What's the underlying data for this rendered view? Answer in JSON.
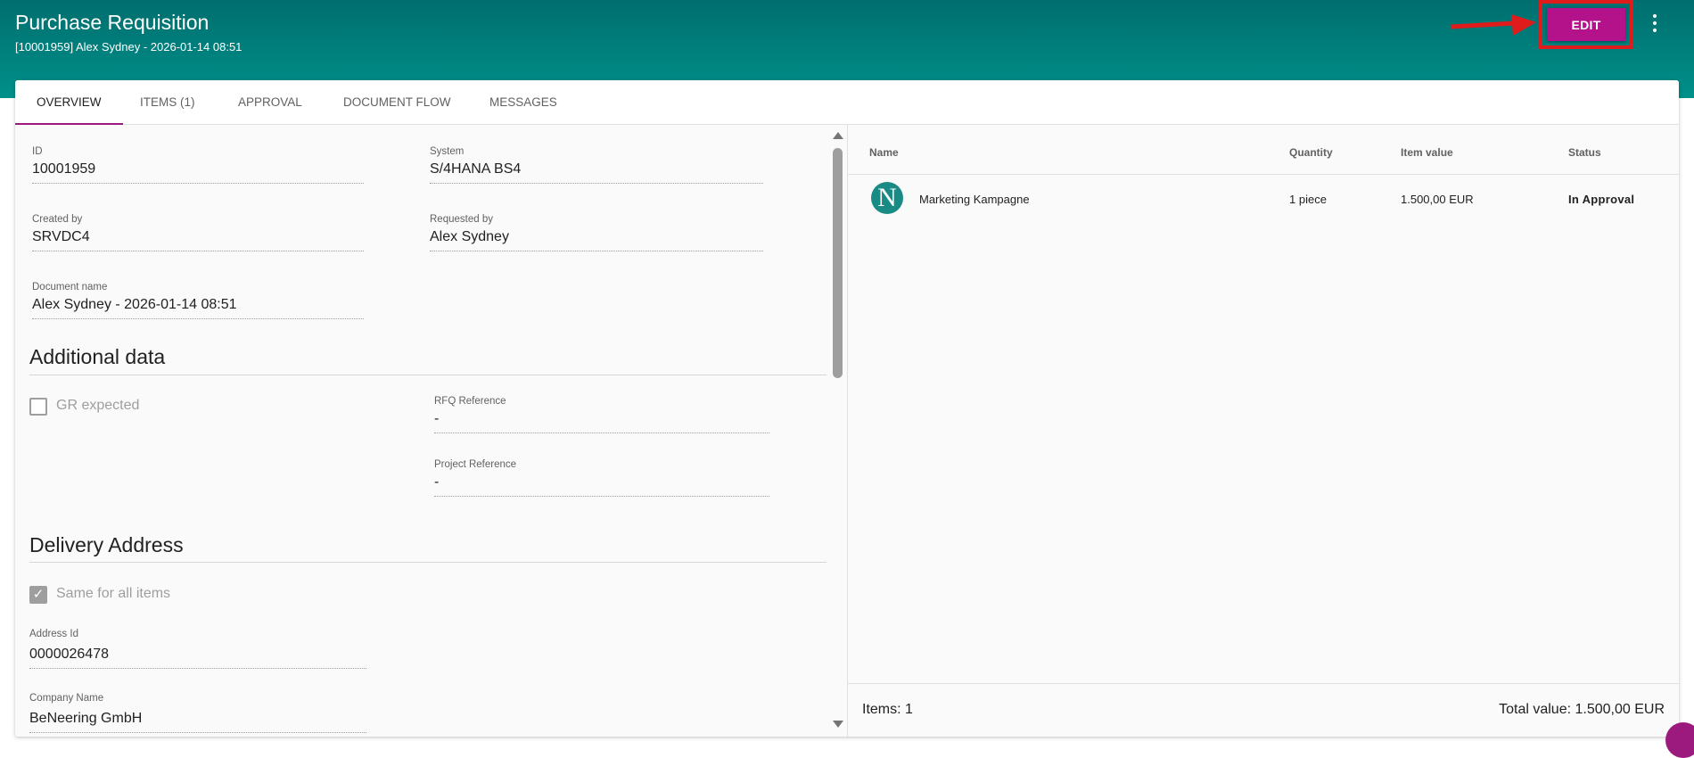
{
  "header": {
    "title": "Purchase Requisition",
    "subtitle": "[10001959] Alex Sydney - 2026-01-14 08:51",
    "edit_label": "EDIT",
    "more_icon": "more-vert-icon",
    "colors": {
      "header_start": "#006e6e",
      "header_end": "#00908a",
      "edit_button": "#b3128a",
      "highlight": "#e01b1b"
    }
  },
  "tabs": [
    {
      "label": "OVERVIEW",
      "active": true
    },
    {
      "label": "ITEMS (1)",
      "active": false
    },
    {
      "label": "APPROVAL",
      "active": false
    },
    {
      "label": "DOCUMENT FLOW",
      "active": false
    },
    {
      "label": "MESSAGES",
      "active": false
    }
  ],
  "overview": {
    "id": {
      "label": "ID",
      "value": "10001959"
    },
    "system": {
      "label": "System",
      "value": "S/4HANA BS4"
    },
    "created_by": {
      "label": "Created by",
      "value": "SRVDC4"
    },
    "requested_by": {
      "label": "Requested by",
      "value": "Alex Sydney"
    },
    "document_name": {
      "label": "Document name",
      "value": "Alex Sydney - 2026-01-14 08:51"
    }
  },
  "additional_data": {
    "title": "Additional data",
    "gr_expected": {
      "label": "GR expected",
      "checked": false
    },
    "rfq_reference": {
      "label": "RFQ Reference",
      "value": "-"
    },
    "project_reference": {
      "label": "Project Reference",
      "value": "-"
    }
  },
  "delivery_address": {
    "title": "Delivery Address",
    "same_for_all": {
      "label": "Same for all items",
      "checked": true
    },
    "address_id": {
      "label": "Address Id",
      "value": "0000026478"
    },
    "company_name": {
      "label": "Company Name",
      "value": "BeNeering GmbH"
    }
  },
  "items_table": {
    "headers": {
      "name": "Name",
      "quantity": "Quantity",
      "item_value": "Item value",
      "status": "Status"
    },
    "rows": [
      {
        "logo_letter": "N",
        "name": "Marketing Kampagne",
        "quantity": "1 piece",
        "item_value": "1.500,00 EUR",
        "status": "In Approval"
      }
    ],
    "footer": {
      "items": "Items: 1",
      "total": "Total value:  1.500,00 EUR"
    }
  }
}
